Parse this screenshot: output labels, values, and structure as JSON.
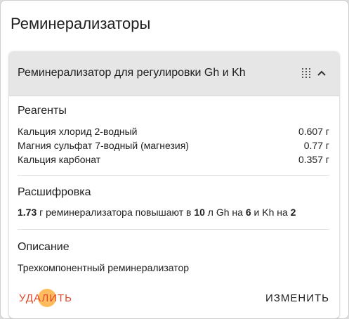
{
  "page": {
    "title": "Реминерализаторы"
  },
  "card": {
    "title": "Реминерализатор для регулировки Gh и Kh",
    "icons": {
      "reorder": "drag-grid-icon",
      "collapse": "chevron-up-icon"
    },
    "reagents": {
      "heading": "Реагенты",
      "items": [
        {
          "name": "Кальция хлорид 2-водный",
          "value": "0.607 г"
        },
        {
          "name": "Магния сульфат 7-водный (магнезия)",
          "value": "0.77 г"
        },
        {
          "name": "Кальция карбонат",
          "value": "0.357 г"
        }
      ]
    },
    "decoding": {
      "heading": "Расшифровка",
      "amount": "1.73",
      "text1": " г реминерализатора повышают в ",
      "volume": "10",
      "text2": " л Gh на ",
      "gh": "6",
      "text3": " и Kh на ",
      "kh": "2"
    },
    "description": {
      "heading": "Описание",
      "text": "Трехкомпонентный реминерализатор"
    },
    "actions": {
      "delete": "Удалить",
      "edit": "Изменить"
    }
  },
  "colors": {
    "accent_delete": "#e24a2b",
    "header_bg": "#e6e6e6",
    "ripple": "#ffa528"
  }
}
